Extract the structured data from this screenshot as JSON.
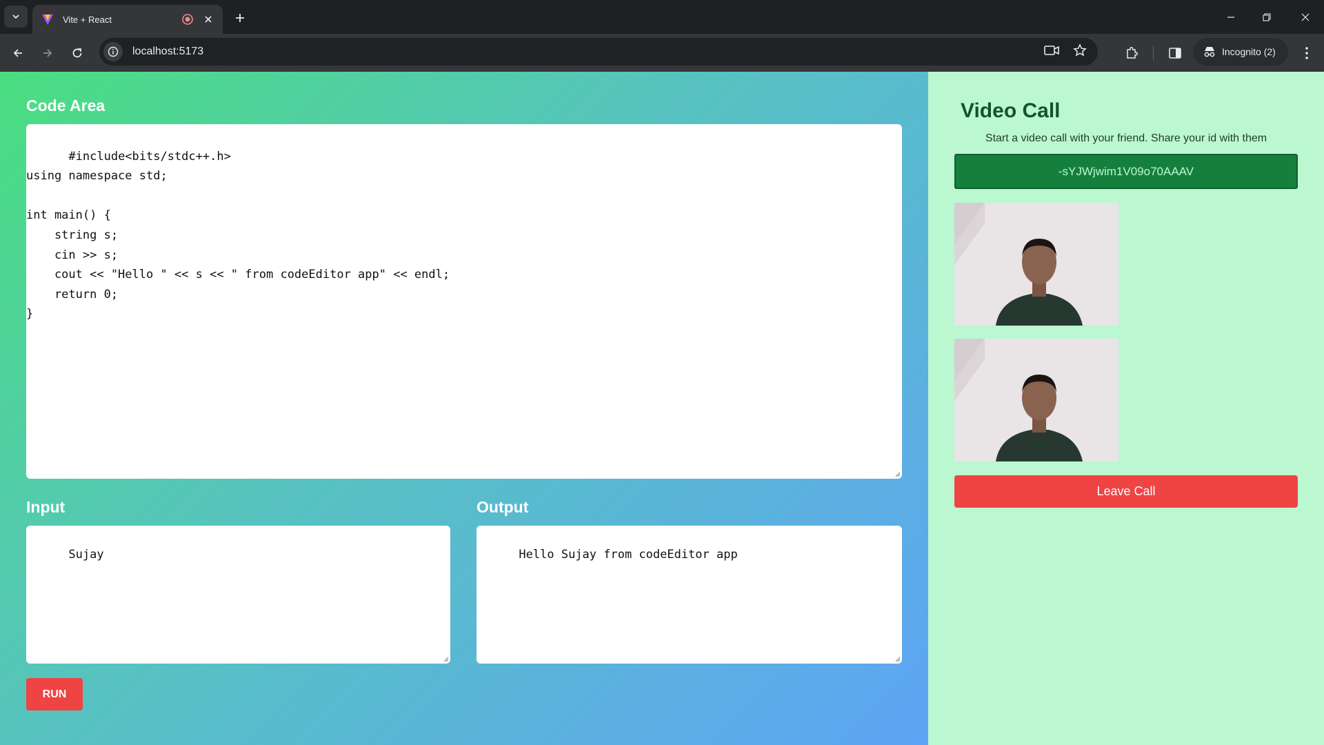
{
  "browser": {
    "tab_title": "Vite + React",
    "url": "localhost:5173",
    "incognito_label": "Incognito (2)"
  },
  "code_area": {
    "title": "Code Area",
    "code": "#include<bits/stdc++.h>\nusing namespace std;\n\nint main() {\n    string s;\n    cin >> s;\n    cout << \"Hello \" << s << \" from codeEditor app\" << endl;\n    return 0;\n}"
  },
  "input": {
    "title": "Input",
    "value": "Sujay"
  },
  "output": {
    "title": "Output",
    "value": "Hello Sujay from codeEditor app"
  },
  "run_button": "RUN",
  "video_call": {
    "title": "Video Call",
    "subtitle": "Start a video call with your friend. Share your id with them",
    "peer_id": "-sYJWjwim1V09o70AAAV",
    "leave_button": "Leave Call"
  },
  "colors": {
    "run_red": "#ef4444",
    "peer_green": "#15803d",
    "panel_mint": "#bbf7d0"
  }
}
